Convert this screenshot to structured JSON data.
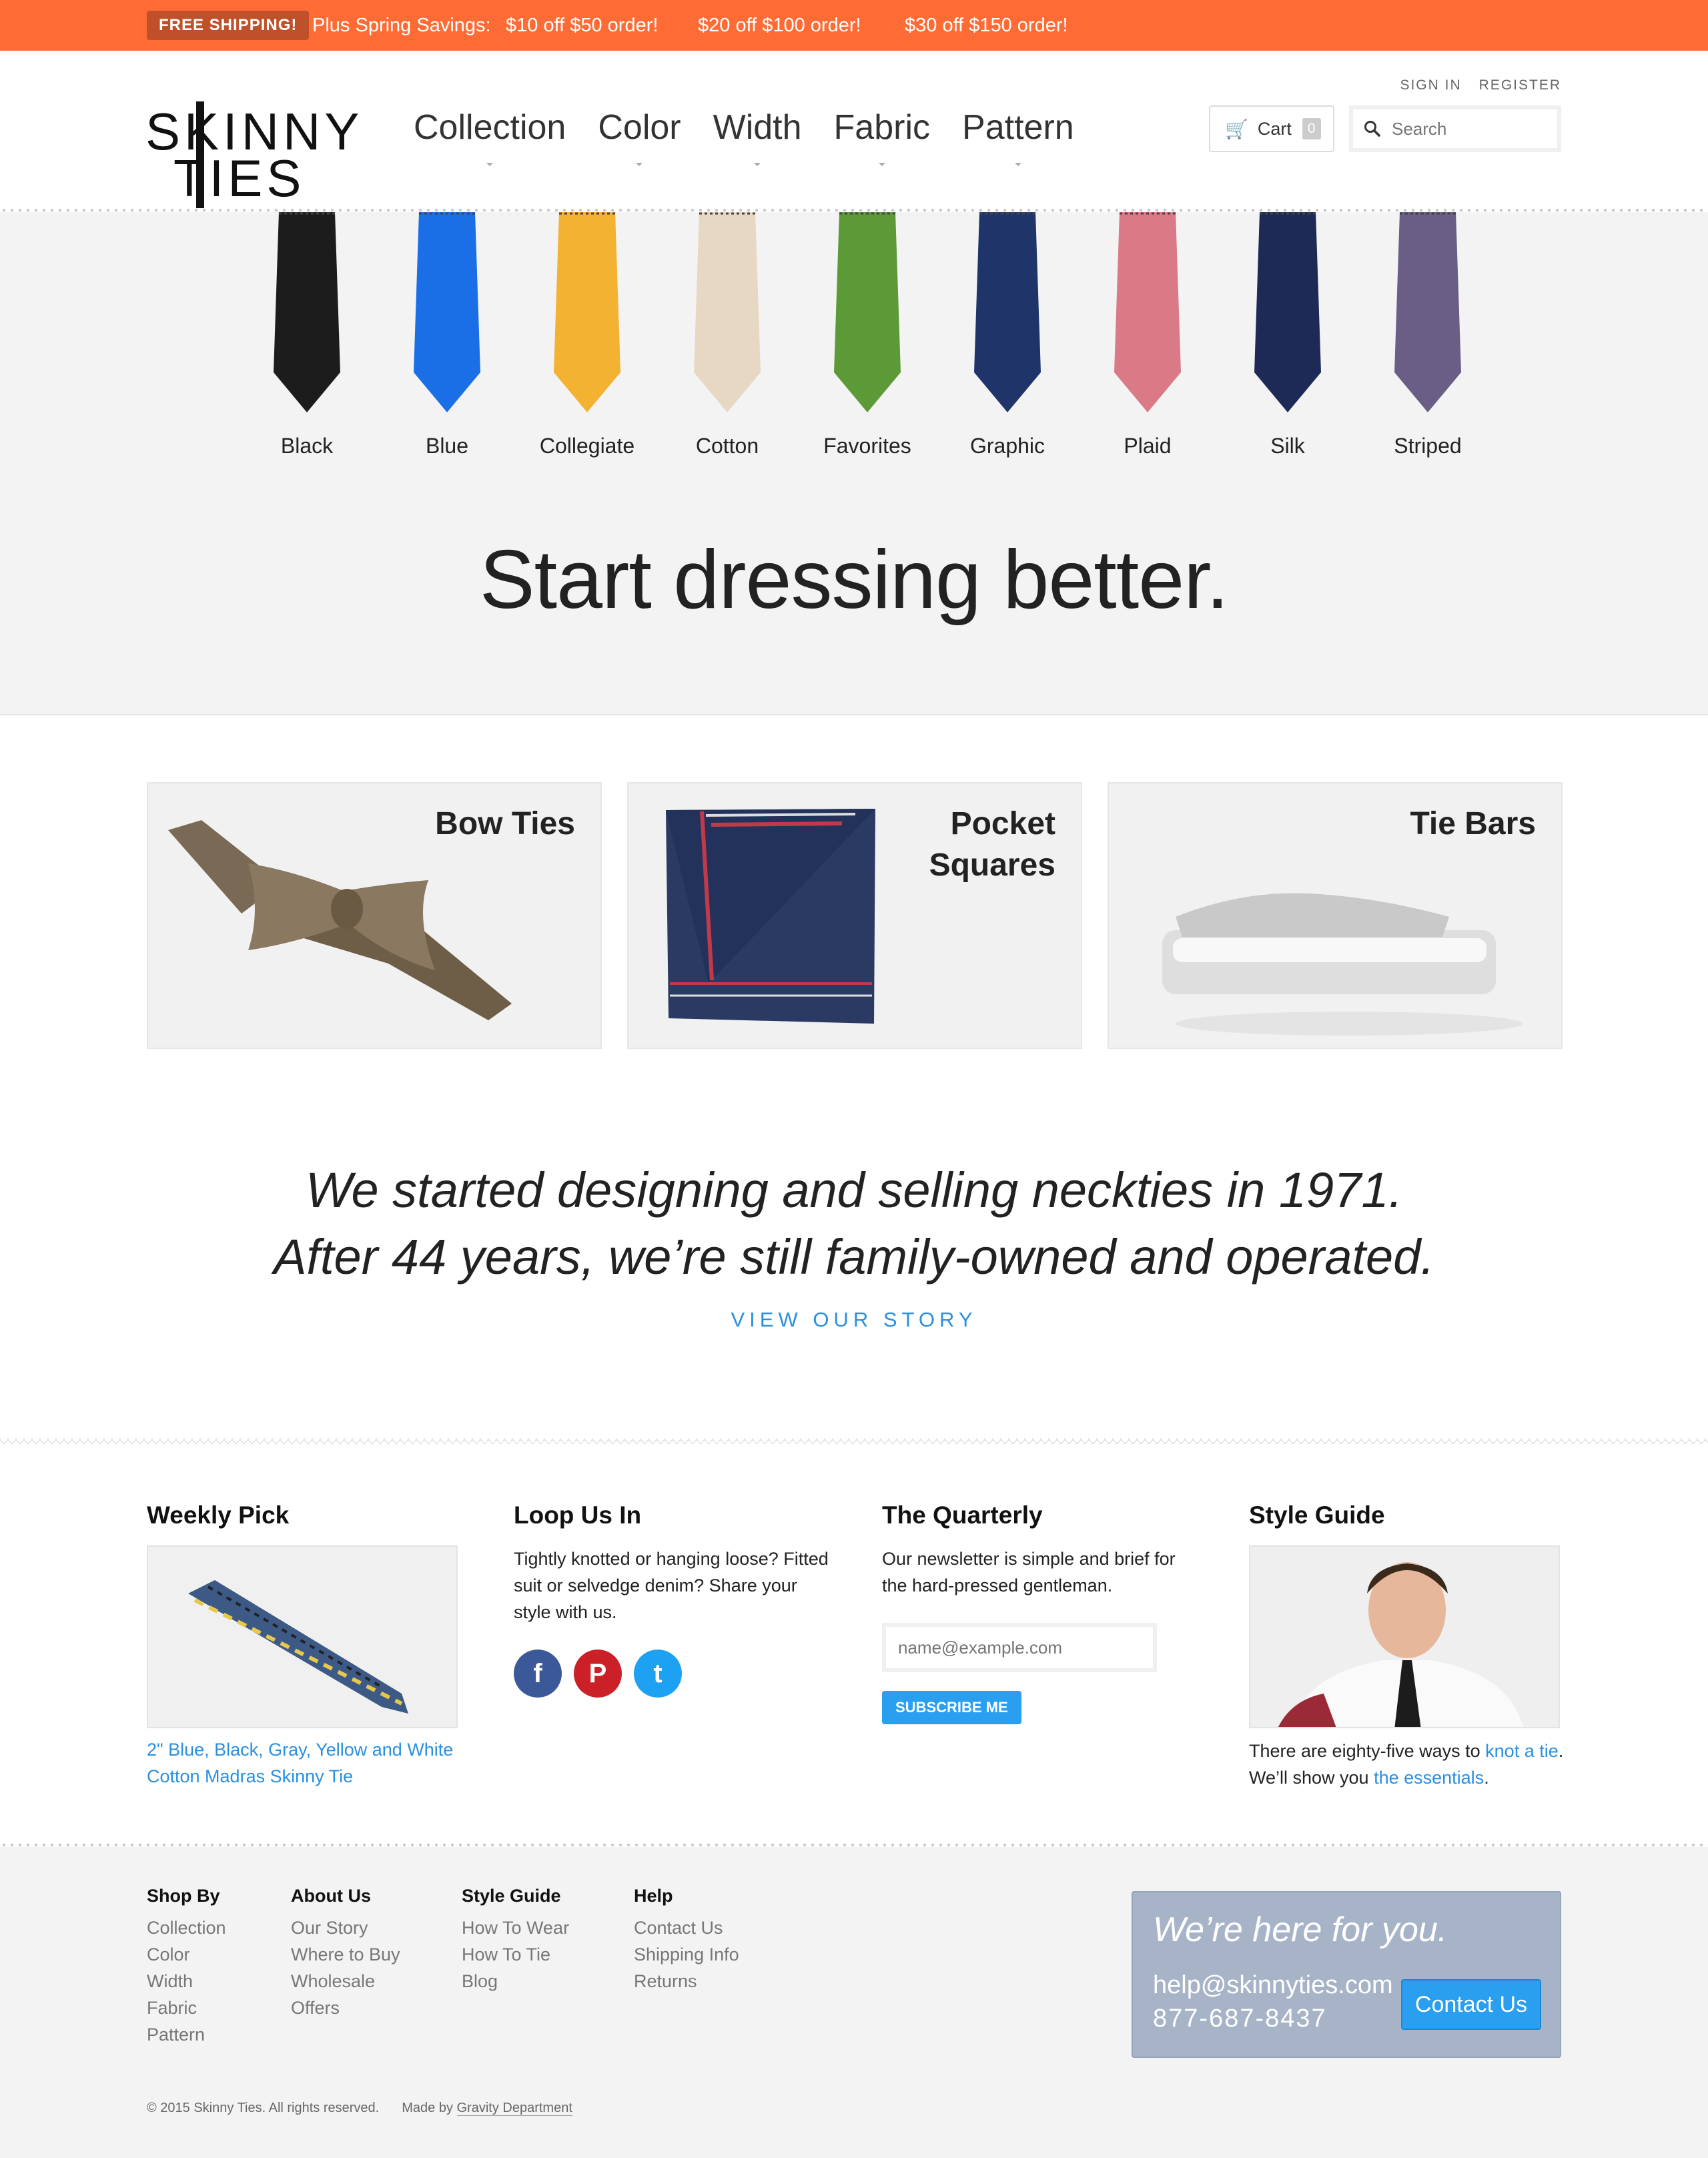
{
  "promo": {
    "badge": "FREE SHIPPING!",
    "intro": "Plus Spring Savings:",
    "offers": [
      "$10 off $50 order!",
      "$20 off $100 order!",
      "$30 off $150 order!"
    ]
  },
  "header": {
    "logo_line1": "SKINNY",
    "logo_line2": "TIES",
    "nav": [
      "Collection",
      "Color",
      "Width",
      "Fabric",
      "Pattern"
    ],
    "sign_in": "SIGN IN",
    "register": "REGISTER",
    "cart_label": "Cart",
    "cart_count": "0",
    "search_placeholder": "Search"
  },
  "ties": [
    {
      "name": "Black",
      "color": "#1c1c1c"
    },
    {
      "name": "Blue",
      "color": "#1b6fe6"
    },
    {
      "name": "Collegiate",
      "color": "#f3b232"
    },
    {
      "name": "Cotton",
      "color": "#e7d8c4"
    },
    {
      "name": "Favorites",
      "color": "#5c9a38"
    },
    {
      "name": "Graphic",
      "color": "#1f3569"
    },
    {
      "name": "Plaid",
      "color": "#d97a86"
    },
    {
      "name": "Silk",
      "color": "#1c2a55"
    },
    {
      "name": "Striped",
      "color": "#6a5d86"
    }
  ],
  "headline": "Start dressing better.",
  "products": [
    {
      "title": "Bow Ties"
    },
    {
      "title": "Pocket\nSquares"
    },
    {
      "title": "Tie Bars"
    }
  ],
  "story": {
    "line1": "We started designing and selling neckties in 1971.",
    "line2": "After 44 years, we’re still family-owned and operated.",
    "link": "VIEW OUR STORY"
  },
  "widgets": {
    "weekly": {
      "title": "Weekly Pick",
      "caption": "2\" Blue, Black, Gray, Yellow and White Cotton Madras Skinny Tie"
    },
    "loop": {
      "title": "Loop Us In",
      "text": "Tightly knotted or hanging loose? Fitted suit or selvedge denim? Share your style with us.",
      "social": [
        "f",
        "P",
        "t"
      ]
    },
    "quarterly": {
      "title": "The Quarterly",
      "text": "Our newsletter is simple and brief for the hard-pressed gentleman.",
      "placeholder": "name@example.com",
      "button": "SUBSCRIBE ME"
    },
    "guide": {
      "title": "Style Guide",
      "text_a": "There are eighty-five ways to ",
      "link_a": "knot a tie",
      "text_b": ".",
      "text_c": "We’ll show you ",
      "link_b": "the essentials",
      "text_d": "."
    }
  },
  "footer": {
    "columns": [
      {
        "title": "Shop By",
        "links": [
          "Collection",
          "Color",
          "Width",
          "Fabric",
          "Pattern"
        ]
      },
      {
        "title": "About Us",
        "links": [
          "Our Story",
          "Where to Buy",
          "Wholesale",
          "Offers"
        ]
      },
      {
        "title": "Style Guide",
        "links": [
          "How To Wear",
          "How To Tie",
          "Blog"
        ]
      },
      {
        "title": "Help",
        "links": [
          "Contact Us",
          "Shipping Info",
          "Returns"
        ]
      }
    ],
    "contact": {
      "title": "We’re here for you.",
      "email": "help@skinnyties.com",
      "phone": "877-687-8437",
      "button": "Contact Us"
    },
    "copyright": "© 2015 Skinny Ties. All rights reserved.",
    "made_by_prefix": "Made by ",
    "made_by": "Gravity Department"
  }
}
